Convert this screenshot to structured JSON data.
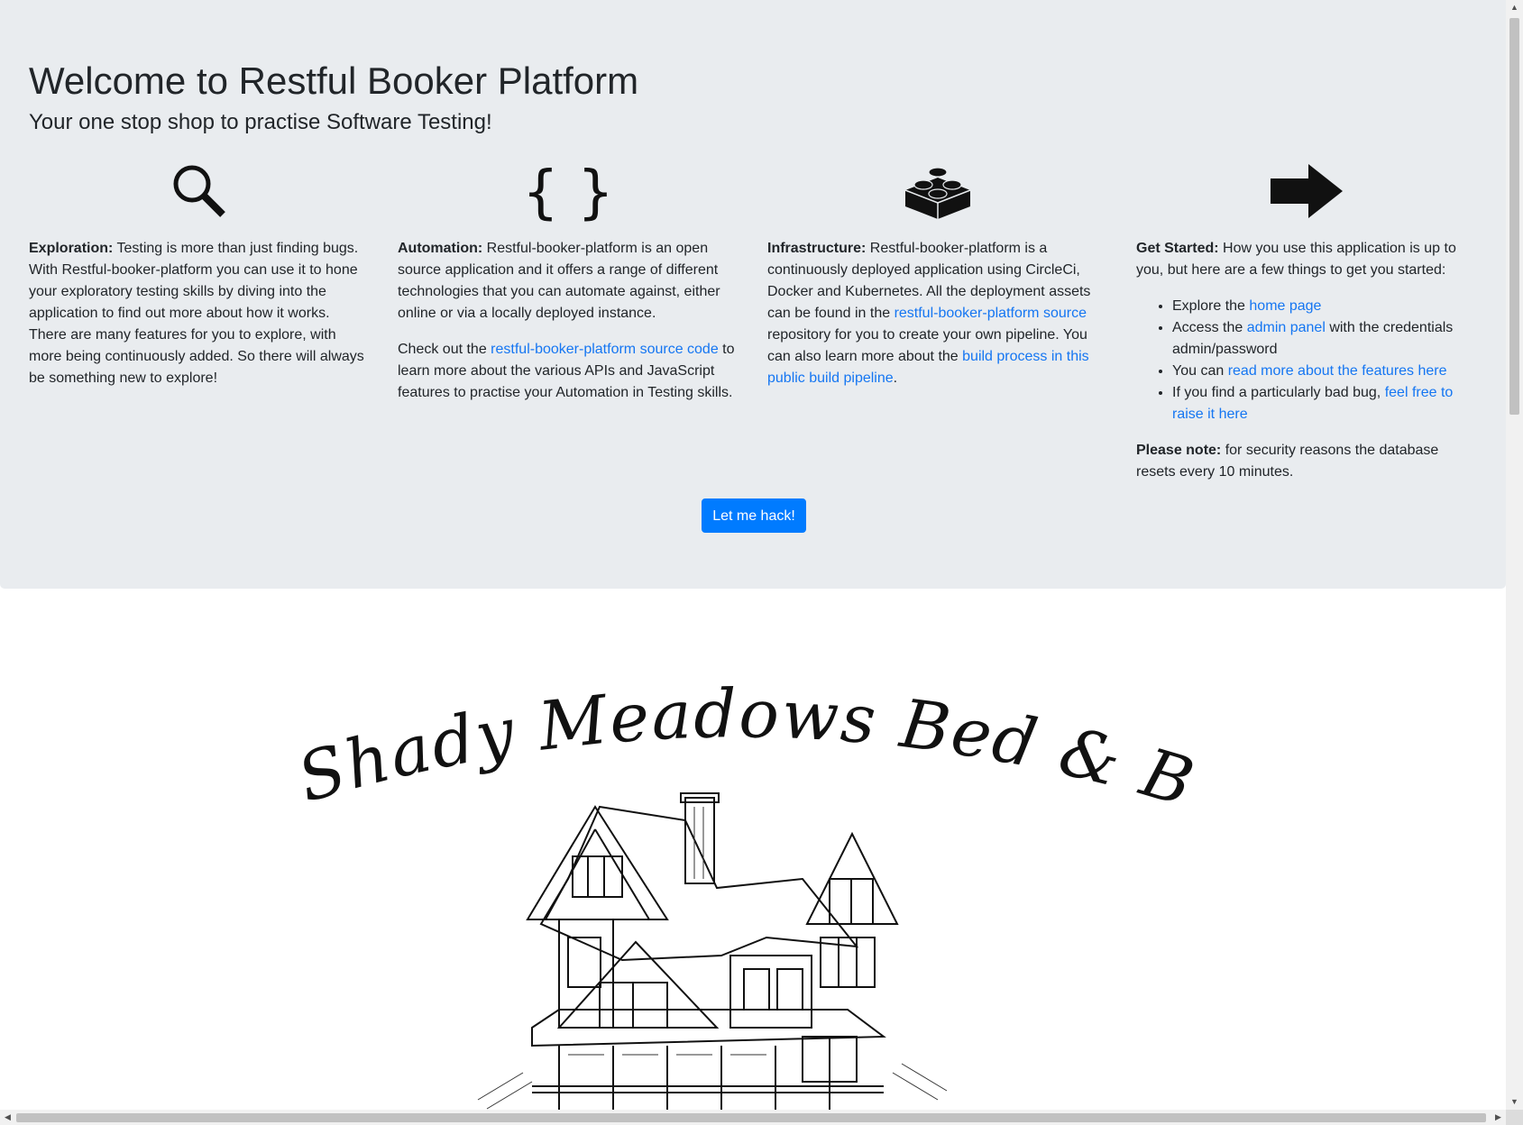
{
  "header": {
    "title": "Welcome to Restful Booker Platform",
    "subtitle": "Your one stop shop to practise Software Testing!"
  },
  "columns": [
    {
      "icon": "magnifying-glass-icon",
      "heading": "Exploration:",
      "text": " Testing is more than just finding bugs. With Restful-booker-platform you can use it to hone your exploratory testing skills by diving into the application to find out more about how it works. There are many features for you to explore, with more being continuously added. So there will always be something new to explore!"
    },
    {
      "icon": "curly-braces-icon",
      "heading": "Automation:",
      "text": " Restful-booker-platform is an open source application and it offers a range of different technologies that you can automate against, either online or via a locally deployed instance.",
      "p2_before": "Check out the ",
      "p2_link": "restful-booker-platform source code",
      "p2_after": " to learn more about the various APIs and JavaScript features to practise your Automation in Testing skills."
    },
    {
      "icon": "lego-brick-icon",
      "heading": "Infrastructure:",
      "text": " Restful-booker-platform is a continuously deployed application using CircleCi, Docker and Kubernetes. All the deployment assets can be found in the ",
      "link1": "restful-booker-platform source",
      "text2": " repository for you to create your own pipeline. You can also learn more about the ",
      "link2": "build process in this public build pipeline",
      "text3": "."
    },
    {
      "icon": "arrow-right-icon",
      "heading": "Get Started:",
      "text": " How you use this application is up to you, but here are a few things to get you started:",
      "items": [
        {
          "before": "Explore the ",
          "link": "home page",
          "after": ""
        },
        {
          "before": "Access the ",
          "link": "admin panel",
          "after": " with the credentials admin/password"
        },
        {
          "before": "You can ",
          "link": "read more about the features here",
          "after": ""
        },
        {
          "before": "If you find a particularly bad bug, ",
          "link": "feel free to raise it here",
          "after": ""
        }
      ],
      "note_heading": "Please note:",
      "note_text": " for security reasons the database resets every 10 minutes."
    }
  ],
  "hack_button": "Let me hack!",
  "logo": {
    "text": "Shady Meadows Bed & Breakfast",
    "image": "house-sketch-illustration"
  },
  "colors": {
    "jumbotron": "#e9ecef",
    "link": "#1576f2",
    "button": "#007bff"
  }
}
